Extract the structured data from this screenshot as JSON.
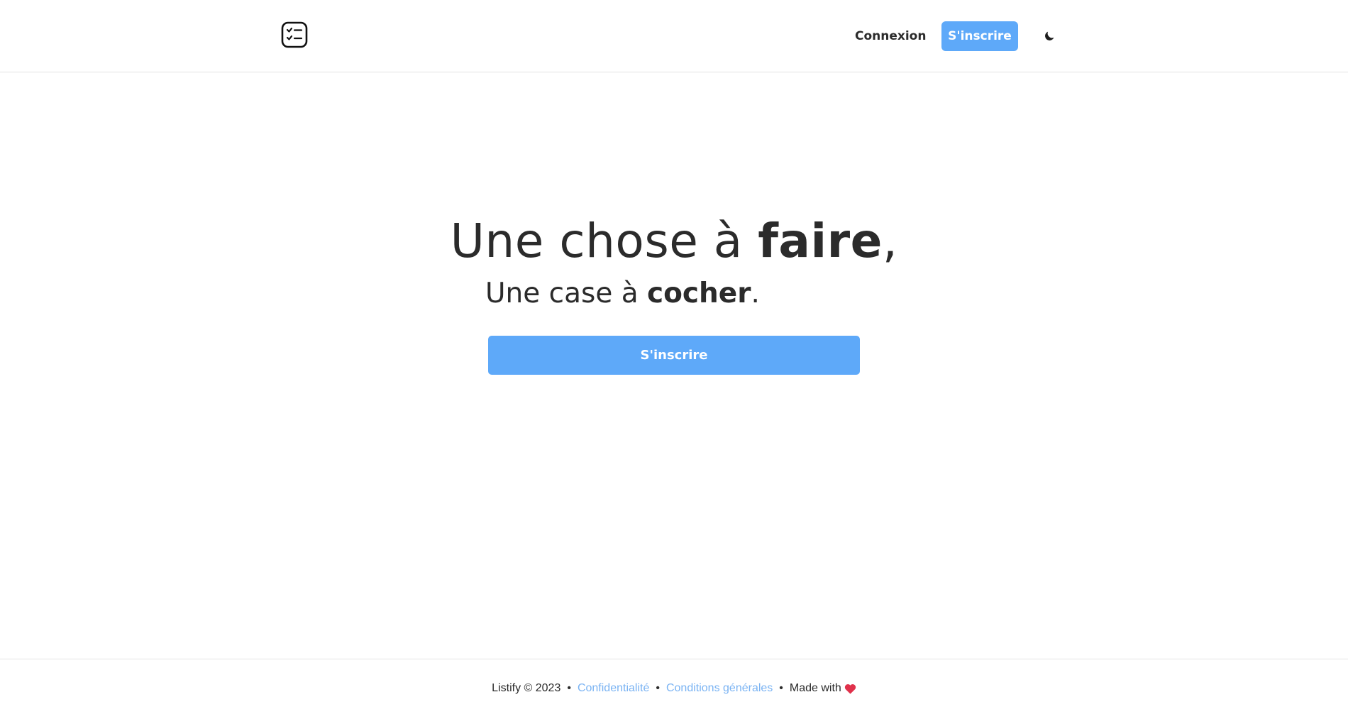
{
  "header": {
    "logo_icon": "checklist-icon",
    "login_label": "Connexion",
    "signup_label": "S'inscrire",
    "theme_icon": "moon-icon"
  },
  "hero": {
    "line1_prefix": "Une chose à ",
    "line1_bold": "faire",
    "line1_suffix": ",",
    "line2_prefix": "Une case à ",
    "line2_bold": "cocher",
    "line2_suffix": ".",
    "cta_label": "S'inscrire"
  },
  "footer": {
    "copyright": "Listify © 2023",
    "separator": "•",
    "privacy_label": "Confidentialité",
    "terms_label": "Conditions générales",
    "made_with": "Made with",
    "heart_icon": "heart-icon"
  },
  "colors": {
    "accent": "#5ea9f9",
    "link": "#7ab3f3",
    "text": "#2b2b2b",
    "heart": "#e0314b"
  }
}
